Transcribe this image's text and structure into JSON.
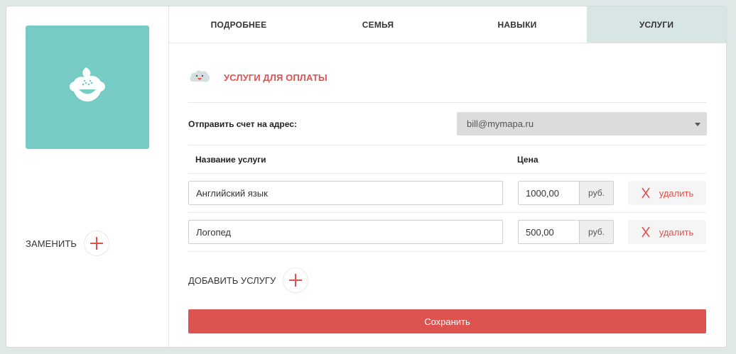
{
  "tabs": [
    {
      "label": "ПОДРОБНЕЕ",
      "active": false
    },
    {
      "label": "СЕМЬЯ",
      "active": false
    },
    {
      "label": "НАВЫКИ",
      "active": false
    },
    {
      "label": "УСЛУГИ",
      "active": true
    }
  ],
  "profile": {
    "avatar_icon": "child-face-icon",
    "replace_label": "ЗАМЕНИТЬ"
  },
  "services": {
    "section_title": "УСЛУГИ ДЛЯ ОПЛАТЫ",
    "section_icon": "cloud-face-icon",
    "address_label": "Отправить счет на адрес:",
    "address_value": "bill@mymapa.ru",
    "column_name": "Название услуги",
    "column_price": "Цена",
    "items": [
      {
        "name": "Английский язык",
        "price": "1000,00",
        "currency": "руб.",
        "delete_label": "удалить"
      },
      {
        "name": "Логопед",
        "price": "500,00",
        "currency": "руб.",
        "delete_label": "удалить"
      }
    ],
    "add_label": "ДОБАВИТЬ УСЛУГУ",
    "save_label": "Сохранить"
  },
  "colors": {
    "accent": "#dd534f",
    "avatar_bg": "#76cbc4",
    "active_tab": "#d7e6e5"
  }
}
